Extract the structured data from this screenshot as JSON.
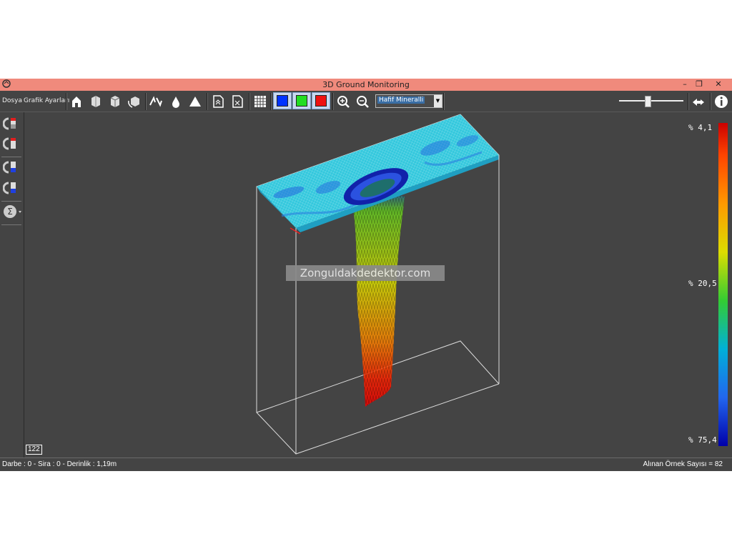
{
  "window": {
    "title": "3D Ground Monitoring",
    "minimize": "–",
    "restore": "❐",
    "close": "✕"
  },
  "menu": {
    "file": "Dosya",
    "graph_settings": "Grafik Ayarları"
  },
  "toolbar": {
    "icons": [
      "home-icon",
      "cube-front-icon",
      "cube-side-icon",
      "cube-rotate-icon",
      "rotate-left-right-icon",
      "drop-icon",
      "triangle-icon",
      "file-up-icon",
      "file-x-icon",
      "grid-icon",
      "color-blue-icon",
      "color-green-icon",
      "color-red-icon",
      "zoom-in-icon",
      "zoom-out-icon",
      "transfer-icon",
      "info-icon"
    ],
    "colors": {
      "blue": "#0033ff",
      "green": "#22dd22",
      "red": "#ee1111"
    },
    "mode_select": {
      "value": "Hafif Mineralli"
    },
    "slider": {
      "value": 0.45
    }
  },
  "left_panel": {
    "icons": [
      "magnet-red-icon",
      "magnet-red-icon",
      "magnet-blue-icon",
      "magnet-blue-icon",
      "sum-icon"
    ]
  },
  "viewport": {
    "watermark": "Zonguldakdedektor.com",
    "counter": "122",
    "scale_labels": {
      "top": "% 4,1",
      "middle": "% 20,5",
      "bottom": "% 75,4"
    }
  },
  "status": {
    "left": "Darbe : 0 - Sira : 0 - Derinlik : 1,19m",
    "right": "Alınan Örnek Sayısı = 82"
  }
}
